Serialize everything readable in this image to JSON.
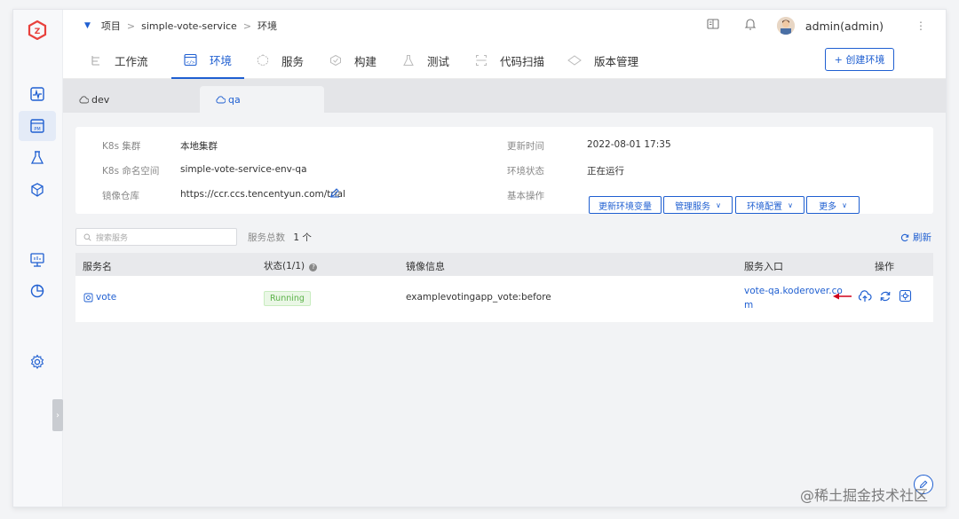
{
  "breadcrumb": {
    "project": "项目",
    "service": "simple-vote-service",
    "section": "环境",
    "separator": ">"
  },
  "user": {
    "name": "admin(admin)"
  },
  "tabs": [
    {
      "label": "工作流",
      "icon": "workflow-icon"
    },
    {
      "label": "环境",
      "icon": "code-env-icon",
      "active": true
    },
    {
      "label": "服务",
      "icon": "cube-icon"
    },
    {
      "label": "构建",
      "icon": "build-icon"
    },
    {
      "label": "测试",
      "icon": "flask-icon"
    },
    {
      "label": "代码扫描",
      "icon": "scan-icon"
    },
    {
      "label": "版本管理",
      "icon": "version-icon"
    }
  ],
  "create_env_label": "+ 创建环境",
  "env_tabs": [
    {
      "label": "dev",
      "active": false
    },
    {
      "label": "qa",
      "active": true
    }
  ],
  "info": {
    "cluster_label": "K8s 集群",
    "cluster_value": "本地集群",
    "namespace_label": "K8s 命名空间",
    "namespace_value": "simple-vote-service-env-qa",
    "registry_label": "镜像仓库",
    "registry_value": "https://ccr.ccs.tencentyun.com/trial",
    "updated_label": "更新时间",
    "updated_value": "2022-08-01 17:35",
    "status_label": "环境状态",
    "status_value": "正在运行",
    "ops_label": "基本操作"
  },
  "ops": {
    "update_vars": "更新环境变量",
    "manage_services": "管理服务",
    "env_config": "环境配置",
    "more": "更多"
  },
  "search": {
    "placeholder": "搜索服务"
  },
  "service_count": {
    "label": "服务总数",
    "value": "1 个"
  },
  "refresh_label": "刷新",
  "table": {
    "headers": {
      "name": "服务名",
      "status": "状态(1/1)",
      "image": "镜像信息",
      "entry": "服务入口",
      "actions": "操作"
    },
    "rows": [
      {
        "name": "vote",
        "status": "Running",
        "image": "examplevotingapp_vote:before",
        "entry_line1": "vote-qa.koderover.co",
        "entry_line2": "m"
      }
    ]
  },
  "watermark": "@稀土掘金技术社区",
  "colors": {
    "accent": "#1f5fd1",
    "running_green": "#5cb24a",
    "arrow_red": "#d0021b"
  }
}
